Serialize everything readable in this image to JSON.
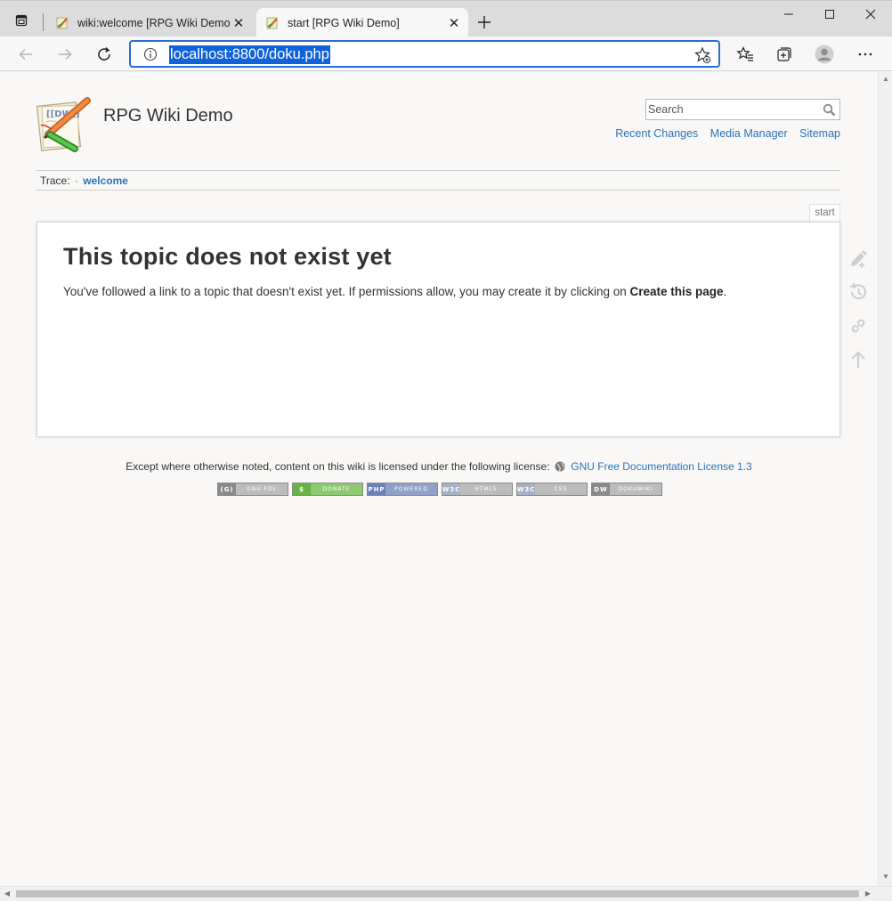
{
  "browser": {
    "tabs": [
      {
        "title": "wiki:welcome [RPG Wiki Demo]",
        "active": false
      },
      {
        "title": "start [RPG Wiki Demo]",
        "active": true
      }
    ],
    "close_glyph": "✕",
    "new_tab_glyph": "+",
    "address": "localhost:8800/doku.php",
    "accent": "#2a6dd4"
  },
  "site": {
    "title": "RPG Wiki Demo",
    "search_placeholder": "Search",
    "links": [
      "Recent Changes",
      "Media Manager",
      "Sitemap"
    ],
    "trace_label": "Trace:",
    "trace_sep": "·",
    "trace_item": "welcome",
    "page_id": "start",
    "link_color": "#2b73b7"
  },
  "content": {
    "heading": "This topic does not exist yet",
    "text": "You've followed a link to a topic that doesn't exist yet. If permissions allow, you may create it by clicking on ",
    "create_link": "Create this page",
    "text_end": "."
  },
  "footer": {
    "license_text": "Except where otherwise noted, content on this wiki is licensed under the following license:",
    "license_link": "GNU Free Documentation License 1.3",
    "badges": [
      {
        "left": "(G)",
        "right": "GNU FDL",
        "color": "#8a8a8a"
      },
      {
        "left": "$",
        "right": "DONATE",
        "color": "#64b544"
      },
      {
        "left": "PHP",
        "right": "POWERED",
        "color": "#6b7fb8"
      },
      {
        "left": "W3C",
        "right": "HTML5",
        "color": "#a7b1c4"
      },
      {
        "left": "W3C",
        "right": "CSS",
        "color": "#a7b1c4"
      },
      {
        "left": "DW",
        "right": "DOKUWIKI",
        "color": "#8a8a8a"
      }
    ]
  },
  "icons": [
    "tab-actions-icon",
    "dokuwiki-favicon-icon",
    "back-icon",
    "forward-icon",
    "refresh-icon",
    "info-icon",
    "add-favorite-icon",
    "favorites-icon",
    "collections-icon",
    "profile-icon",
    "more-icon",
    "search-icon",
    "edit-icon",
    "history-icon",
    "backlinks-icon",
    "back-to-top-icon",
    "globe-icon"
  ]
}
